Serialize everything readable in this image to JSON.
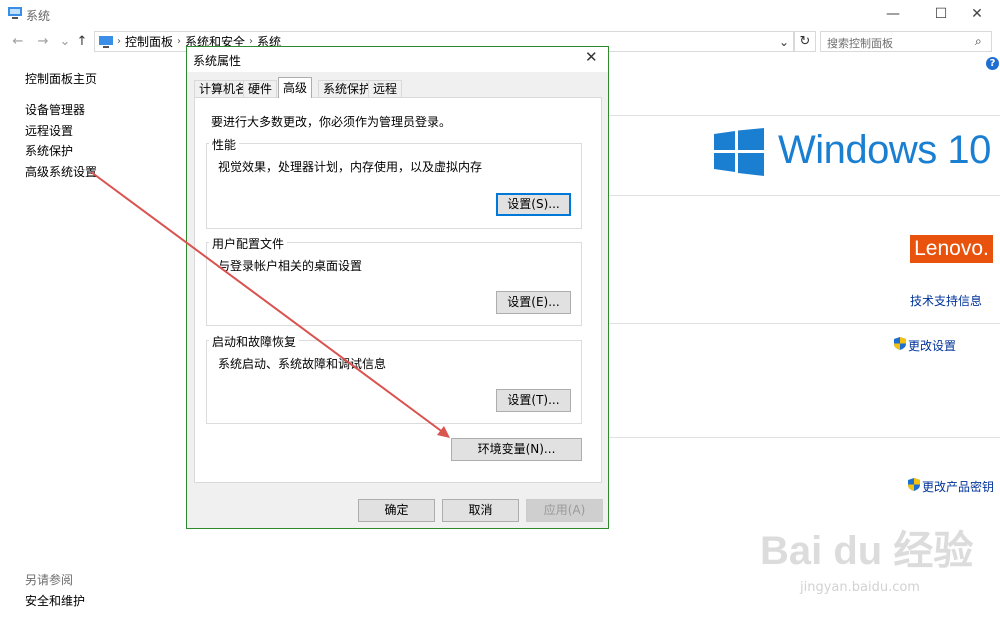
{
  "window": {
    "title": "系统",
    "minimize_glyph": "—",
    "maximize_glyph": "☐",
    "close_glyph": "✕"
  },
  "nav": {
    "back_glyph": "←",
    "forward_glyph": "→",
    "recent_glyph": "⌄",
    "up_glyph": "↑"
  },
  "address": {
    "crumbs": [
      "控制面板",
      "系统和安全",
      "系统"
    ],
    "separator": "›",
    "dropdown_glyph": "⌄",
    "refresh_glyph": "↻"
  },
  "search": {
    "placeholder": "搜索控制面板",
    "icon_glyph": "⌕"
  },
  "help_glyph": "?",
  "left_nav": {
    "home": "控制面板主页",
    "items": [
      "设备管理器",
      "远程设置",
      "系统保护",
      "高级系统设置"
    ],
    "see_also_title": "另请参阅",
    "see_also_items": [
      "安全和维护"
    ]
  },
  "right": {
    "windows_text": "Windows 10",
    "brand_text": "Lenovo.",
    "support_link": "技术支持信息",
    "change_settings_link": "更改设置",
    "change_key_link": "更改产品密钥"
  },
  "dialog": {
    "title": "系统属性",
    "close_glyph": "✕",
    "tabs": [
      "计算机名",
      "硬件",
      "高级",
      "系统保护",
      "远程"
    ],
    "active_tab": "高级",
    "admin_note": "要进行大多数更改，你必须作为管理员登录。",
    "groups": [
      {
        "label": "性能",
        "desc": "视觉效果，处理器计划，内存使用，以及虚拟内存",
        "button": "设置(S)..."
      },
      {
        "label": "用户配置文件",
        "desc": "与登录帐户相关的桌面设置",
        "button": "设置(E)..."
      },
      {
        "label": "启动和故障恢复",
        "desc": "系统启动、系统故障和调试信息",
        "button": "设置(T)..."
      }
    ],
    "env_button": "环境变量(N)...",
    "ok_button": "确定",
    "cancel_button": "取消",
    "apply_button": "应用(A)"
  },
  "watermark": {
    "brand": "Bai du 经验",
    "url": "jingyan.baidu.com"
  },
  "colors": {
    "accent": "#0078d7",
    "link": "#003399",
    "dialog_border": "#2d8a2d",
    "arrow": "#d9534f",
    "windows_blue": "#1a7fd1",
    "lenovo_orange": "#e8520c"
  }
}
